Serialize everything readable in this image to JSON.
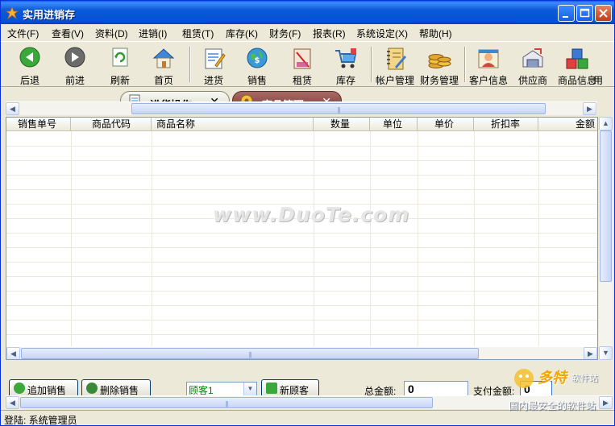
{
  "window": {
    "title": "实用进销存"
  },
  "menu": [
    {
      "label": "文件(F)"
    },
    {
      "label": "查看(V)"
    },
    {
      "label": "资料(D)"
    },
    {
      "label": "进销(I)"
    },
    {
      "label": "租赁(T)"
    },
    {
      "label": "库存(K)"
    },
    {
      "label": "财务(F)"
    },
    {
      "label": "报表(R)"
    },
    {
      "label": "系统设定(X)"
    },
    {
      "label": "帮助(H)"
    }
  ],
  "toolbar": [
    {
      "label": "后退",
      "icon": "back-arrow-icon"
    },
    {
      "label": "前进",
      "icon": "forward-arrow-icon"
    },
    {
      "label": "刷新",
      "icon": "refresh-icon"
    },
    {
      "label": "首页",
      "icon": "home-icon"
    },
    {
      "label": "进货",
      "icon": "purchase-icon"
    },
    {
      "label": "销售",
      "icon": "sales-globe-icon"
    },
    {
      "label": "租赁",
      "icon": "lease-icon"
    },
    {
      "label": "库存",
      "icon": "inventory-cart-icon"
    },
    {
      "label": "帐户管理",
      "icon": "account-notebook-icon"
    },
    {
      "label": "财务管理",
      "icon": "finance-coins-icon"
    },
    {
      "label": "客户信息",
      "icon": "customer-icon"
    },
    {
      "label": "供应商",
      "icon": "supplier-icon"
    },
    {
      "label": "商品信息",
      "icon": "product-cubes-icon"
    },
    {
      "label": "用",
      "icon": "more-icon"
    }
  ],
  "tabs": [
    {
      "label": "进货操作",
      "close": "✕"
    },
    {
      "label": "商品管理",
      "close": "✕"
    }
  ],
  "grid": {
    "columns": [
      "销售单号",
      "商品代码",
      "商品名称",
      "数量",
      "单位",
      "单价",
      "折扣率",
      "金额"
    ],
    "rows": []
  },
  "actions": {
    "add_sale": "追加销售",
    "delete_sale": "删除销售",
    "customer_value": "顾客1",
    "new_customer": "新顾客",
    "total_label": "总金额:",
    "total_value": "0",
    "paid_label": "支付金额:",
    "paid_value": "0"
  },
  "status": {
    "text": "登陆: 系统管理员"
  },
  "watermark": {
    "text": "www.DuoTe.com"
  },
  "brand": {
    "name": "多特",
    "sub": "软件站",
    "tagline": "国内最安全的软件站"
  },
  "colors": {
    "titlebar": "#0a5ad6",
    "tab_active_bg": "#7a3a34",
    "combo_text": "#008000",
    "brand_accent": "#f0a800"
  }
}
